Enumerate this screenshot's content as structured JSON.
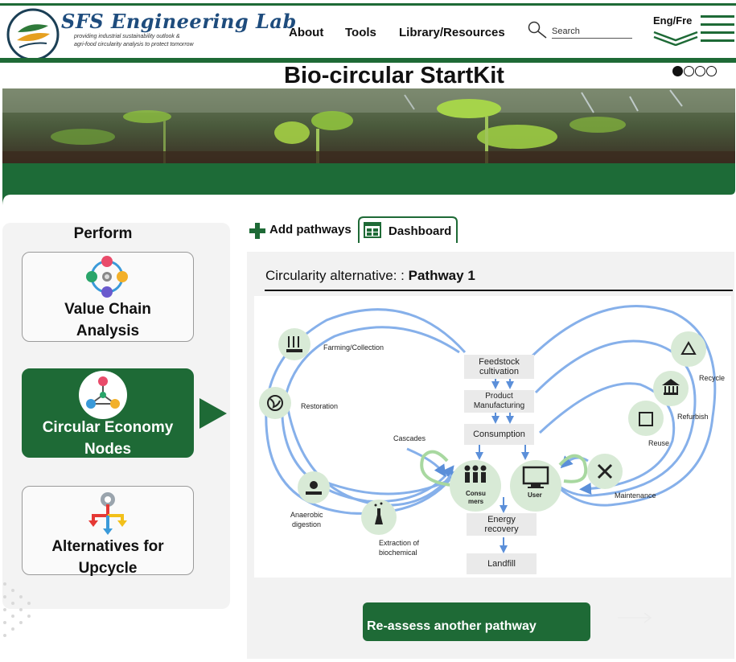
{
  "header": {
    "brand_title": "SFS Engineering Lab",
    "brand_tagline_line1": "providing industrial sustainability outlook &",
    "brand_tagline_line2": "agri-food circularity analysis to protect tomorrow",
    "nav": [
      "About",
      "Tools",
      "Library/Resources"
    ],
    "search_placeholder": "Search",
    "language_label": "Eng/Fre"
  },
  "page": {
    "title": "Bio-circular StartKit",
    "carousel_dots": 4,
    "carousel_active": 0
  },
  "sidebar": {
    "title": "Perform",
    "cards": [
      {
        "line1": "Value Chain",
        "line2": "Analysis",
        "icon": "value-chain-icon",
        "active": false
      },
      {
        "line1": "Circular Economy",
        "line2": "Nodes",
        "icon": "network-nodes-icon",
        "active": true
      },
      {
        "line1": "Alternatives for",
        "line2": "Upcycle",
        "icon": "split-arrows-icon",
        "active": false
      }
    ]
  },
  "tabs": {
    "add_pathways": "Add pathways",
    "dashboard": "Dashboard"
  },
  "main": {
    "title_prefix": "Circularity alternative: :",
    "title_pathway": "Pathway 1",
    "reassess_button": "Re-assess another pathway"
  },
  "diagram": {
    "boxes": {
      "feedstock_1": "Feedstock",
      "feedstock_2": "cultivation",
      "product_1": "Product",
      "product_2": "Manufacturing",
      "consumption": "Consumption",
      "energy_1": "Energy",
      "energy_2": "recovery",
      "landfill": "Landfill"
    },
    "nodes": {
      "consumers_1": "Consu",
      "consumers_2": "mers",
      "user": "User"
    },
    "labels": {
      "farming": "Farming/Collection",
      "restoration": "Restoration",
      "cascades": "Cascades",
      "anaerobic_1": "Anaerobic",
      "anaerobic_2": "digestion",
      "extraction_1": "Extraction of",
      "extraction_2": "biochemical",
      "recycle": "Recycle",
      "refurbish": "Refurbish",
      "reuse": "Reuse",
      "maintenance": "Maintenance"
    }
  },
  "colors": {
    "brand_green": "#1e6a36",
    "brand_blue": "#1e4c7d",
    "flow_blue": "#6fa0e0",
    "node_green": "#d8ead6"
  }
}
